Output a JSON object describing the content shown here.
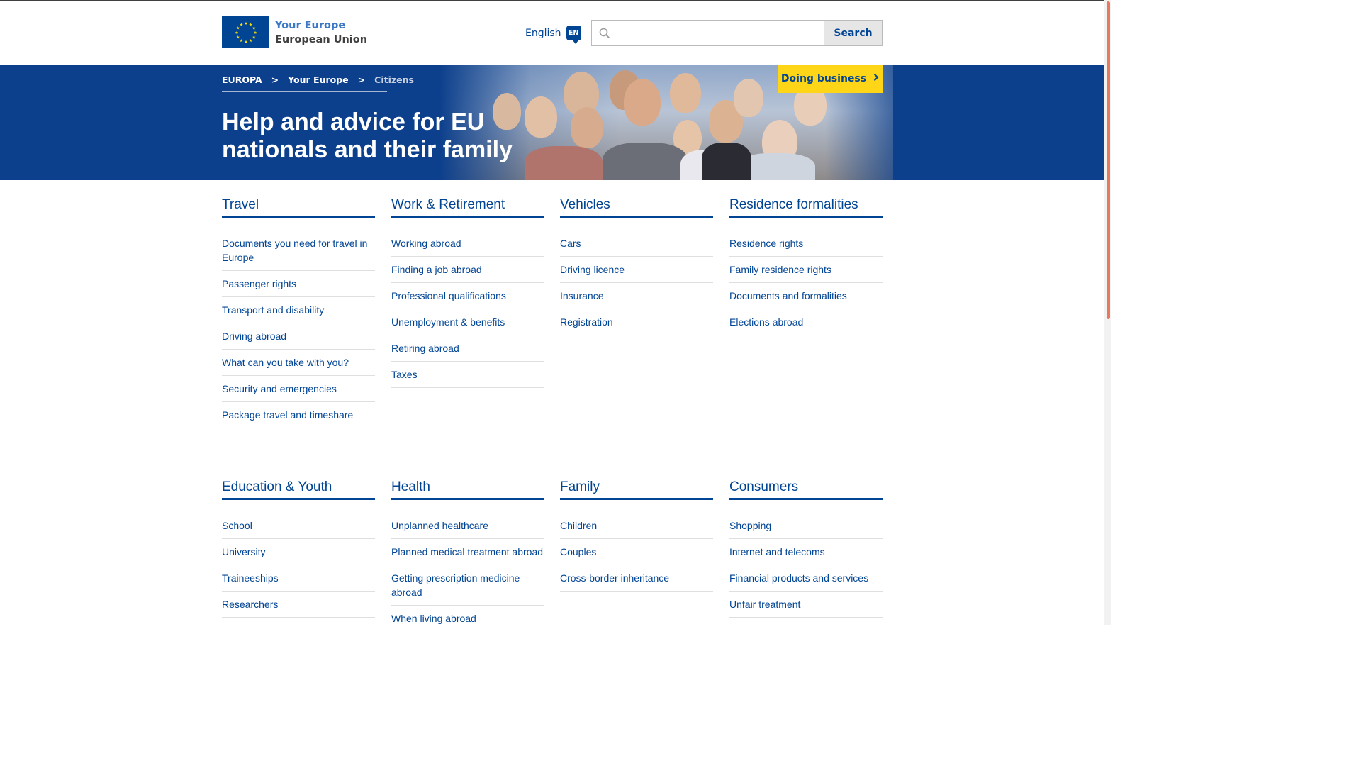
{
  "header": {
    "logo_title": "Your Europe",
    "logo_subtitle": "European Union",
    "language_label": "English",
    "language_code": "EN",
    "search_placeholder": "",
    "search_button": "Search"
  },
  "breadcrumb": {
    "items": [
      "EUROPA",
      "Your Europe",
      "Citizens"
    ],
    "separator": ">"
  },
  "hero": {
    "title": "Help and advice for EU nationals and their family",
    "doing_business": "Doing business"
  },
  "categories": [
    {
      "title": "Travel",
      "links": [
        "Documents you need for travel in Europe",
        "Passenger rights",
        "Transport and disability",
        "Driving abroad",
        "What can you take with you?",
        "Security and emergencies",
        "Package travel and timeshare"
      ]
    },
    {
      "title": "Work & Retirement",
      "links": [
        "Working abroad",
        "Finding a job abroad",
        "Professional qualifications",
        "Unemployment & benefits",
        "Retiring abroad",
        "Taxes"
      ]
    },
    {
      "title": "Vehicles",
      "links": [
        "Cars",
        "Driving licence",
        "Insurance",
        "Registration"
      ]
    },
    {
      "title": "Residence formalities",
      "links": [
        "Residence rights",
        "Family residence rights",
        "Documents and formalities",
        "Elections abroad"
      ]
    },
    {
      "title": "Education & Youth",
      "links": [
        "School",
        "University",
        "Traineeships",
        "Researchers"
      ]
    },
    {
      "title": "Health",
      "links": [
        "Unplanned healthcare",
        "Planned medical treatment abroad",
        "Getting prescription medicine abroad",
        "When living abroad"
      ]
    },
    {
      "title": "Family",
      "links": [
        "Children",
        "Couples",
        "Cross-border inheritance"
      ]
    },
    {
      "title": "Consumers",
      "links": [
        "Shopping",
        "Internet and telecoms",
        "Financial products and services",
        "Unfair treatment"
      ]
    }
  ],
  "colors": {
    "brand_blue": "#004494",
    "hero_blue": "#0c3f8c",
    "accent_yellow": "#ffd617",
    "scroll_thumb": "#e8795d"
  },
  "icons": {
    "flag": "eu-flag-icon",
    "language": "speech-bubble-icon",
    "search": "magnifier-icon",
    "chevron": "chevron-right-icon"
  }
}
